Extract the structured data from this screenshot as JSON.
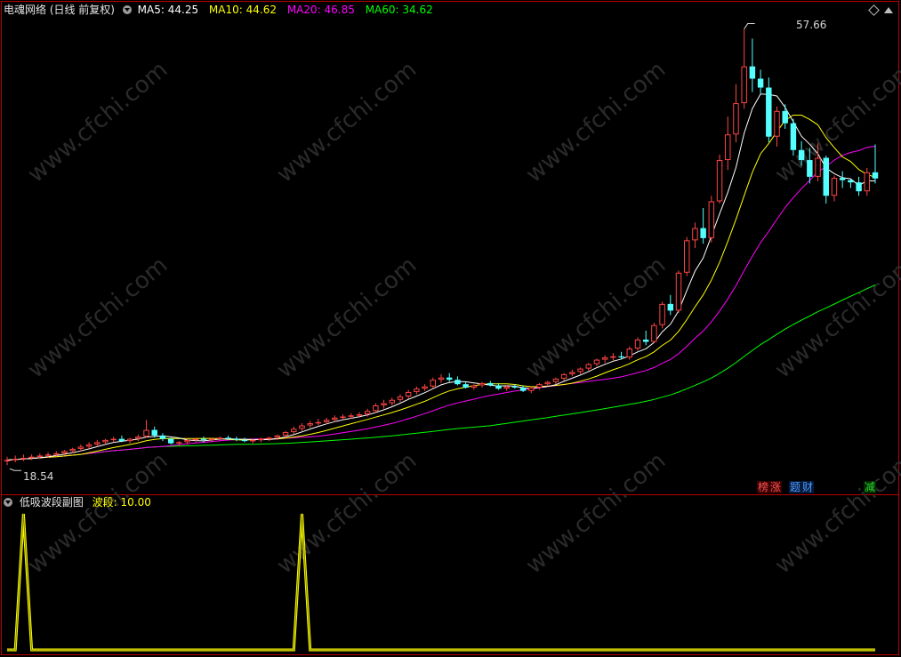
{
  "main_panel": {
    "title": "电魂网络 (日线 前复权)",
    "ma": [
      {
        "label": "MA5:",
        "value": "44.25",
        "color": "#ffffff"
      },
      {
        "label": "MA10:",
        "value": "44.62",
        "color": "#ffff00"
      },
      {
        "label": "MA20:",
        "value": "46.85",
        "color": "#ff00ff"
      },
      {
        "label": "MA60:",
        "value": "34.62",
        "color": "#00ff00"
      }
    ],
    "high_label": "57.66",
    "low_label": "18.54",
    "tags": [
      {
        "text": "榜",
        "color": "#ff5555"
      },
      {
        "text": "涨",
        "color": "#ff5555"
      },
      {
        "text": "题",
        "color": "#5599ff"
      },
      {
        "text": "财",
        "color": "#5599ff"
      },
      {
        "text": "减",
        "color": "#33dd33"
      }
    ]
  },
  "sub_panel": {
    "title": "低吸波段副图",
    "series_label": "波段:",
    "series_value": "10.00"
  },
  "watermark": "www.cfchi.com",
  "colors": {
    "up": "#ff4444",
    "down": "#54ffff",
    "ma5": "#ffffff",
    "ma10": "#ffff00",
    "ma20": "#ff00ff",
    "ma60": "#00ff00",
    "band": "#ffff00",
    "frame": "#bb0000"
  },
  "chart_data": [
    {
      "type": "candlestick",
      "title": "电魂网络 (日线 前复权)",
      "ylim": [
        18.0,
        58.5
      ],
      "annotations": {
        "high": 57.66,
        "low": 18.54
      },
      "ohlc": [
        [
          18.9,
          19.3,
          18.54,
          19.0
        ],
        [
          19.0,
          19.4,
          18.8,
          19.1
        ],
        [
          19.1,
          19.5,
          18.9,
          19.2
        ],
        [
          19.2,
          19.5,
          19.0,
          19.3
        ],
        [
          19.3,
          19.6,
          19.1,
          19.4
        ],
        [
          19.4,
          19.7,
          19.2,
          19.5
        ],
        [
          19.5,
          19.8,
          19.3,
          19.6
        ],
        [
          19.6,
          19.9,
          19.4,
          19.8
        ],
        [
          19.8,
          20.1,
          19.6,
          20.0
        ],
        [
          20.0,
          20.4,
          19.8,
          20.2
        ],
        [
          20.2,
          20.6,
          20.0,
          20.4
        ],
        [
          20.4,
          20.8,
          20.2,
          20.6
        ],
        [
          20.6,
          20.9,
          20.4,
          20.8
        ],
        [
          20.8,
          21.1,
          20.6,
          20.9
        ],
        [
          20.9,
          21.2,
          20.6,
          20.7
        ],
        [
          20.7,
          21.0,
          20.5,
          20.9
        ],
        [
          20.9,
          21.3,
          20.7,
          21.1
        ],
        [
          21.1,
          22.6,
          21.0,
          21.7
        ],
        [
          21.7,
          22.0,
          21.0,
          21.2
        ],
        [
          21.2,
          21.4,
          20.7,
          20.9
        ],
        [
          20.9,
          21.0,
          20.4,
          20.5
        ],
        [
          20.5,
          20.7,
          20.3,
          20.6
        ],
        [
          20.6,
          20.9,
          20.4,
          20.8
        ],
        [
          20.8,
          21.0,
          20.6,
          20.9
        ],
        [
          20.9,
          21.1,
          20.6,
          20.8
        ],
        [
          20.8,
          21.0,
          20.6,
          20.9
        ],
        [
          20.9,
          21.1,
          20.7,
          21.0
        ],
        [
          21.0,
          21.2,
          20.8,
          20.9
        ],
        [
          20.9,
          21.1,
          20.7,
          20.8
        ],
        [
          20.8,
          21.0,
          20.6,
          20.7
        ],
        [
          20.7,
          20.9,
          20.5,
          20.8
        ],
        [
          20.8,
          21.0,
          20.6,
          20.9
        ],
        [
          20.9,
          21.1,
          20.7,
          21.0
        ],
        [
          21.0,
          21.3,
          20.8,
          21.2
        ],
        [
          21.2,
          21.6,
          21.0,
          21.5
        ],
        [
          21.5,
          22.0,
          21.3,
          21.8
        ],
        [
          21.8,
          22.3,
          21.6,
          22.1
        ],
        [
          22.1,
          22.5,
          21.9,
          22.3
        ],
        [
          22.3,
          22.7,
          22.1,
          22.4
        ],
        [
          22.4,
          22.8,
          22.2,
          22.6
        ],
        [
          22.6,
          23.0,
          22.4,
          22.8
        ],
        [
          22.8,
          23.1,
          22.6,
          22.9
        ],
        [
          22.9,
          23.2,
          22.7,
          23.0
        ],
        [
          23.0,
          23.3,
          22.8,
          23.1
        ],
        [
          23.1,
          23.6,
          22.9,
          23.4
        ],
        [
          23.4,
          24.1,
          23.2,
          23.9
        ],
        [
          23.9,
          24.4,
          23.6,
          24.1
        ],
        [
          24.1,
          24.6,
          23.9,
          24.4
        ],
        [
          24.4,
          24.9,
          24.2,
          24.7
        ],
        [
          24.7,
          25.3,
          24.5,
          25.1
        ],
        [
          25.1,
          25.6,
          24.9,
          25.4
        ],
        [
          25.4,
          25.8,
          25.2,
          25.6
        ],
        [
          25.6,
          26.4,
          25.4,
          26.2
        ],
        [
          26.2,
          26.7,
          25.9,
          26.4
        ],
        [
          26.4,
          26.8,
          26.0,
          26.2
        ],
        [
          26.2,
          26.5,
          25.7,
          25.8
        ],
        [
          25.8,
          26.0,
          25.4,
          25.5
        ],
        [
          25.5,
          25.8,
          25.3,
          25.7
        ],
        [
          25.7,
          26.0,
          25.5,
          25.9
        ],
        [
          25.9,
          26.1,
          25.6,
          25.7
        ],
        [
          25.7,
          25.9,
          25.3,
          25.4
        ],
        [
          25.4,
          25.7,
          25.2,
          25.6
        ],
        [
          25.6,
          25.8,
          25.4,
          25.5
        ],
        [
          25.5,
          25.7,
          25.1,
          25.2
        ],
        [
          25.2,
          25.6,
          25.0,
          25.5
        ],
        [
          25.5,
          25.9,
          25.3,
          25.8
        ],
        [
          25.8,
          26.1,
          25.6,
          26.0
        ],
        [
          26.0,
          26.4,
          25.8,
          26.3
        ],
        [
          26.3,
          26.8,
          26.1,
          26.7
        ],
        [
          26.7,
          27.1,
          26.5,
          26.9
        ],
        [
          26.9,
          27.3,
          26.7,
          27.2
        ],
        [
          27.2,
          27.7,
          27.0,
          27.6
        ],
        [
          27.6,
          28.1,
          27.4,
          28.0
        ],
        [
          28.0,
          28.4,
          27.7,
          28.2
        ],
        [
          28.2,
          28.6,
          27.9,
          28.3
        ],
        [
          28.3,
          28.7,
          28.0,
          28.2
        ],
        [
          28.2,
          29.2,
          28.0,
          29.0
        ],
        [
          29.0,
          30.0,
          28.8,
          29.8
        ],
        [
          29.8,
          30.6,
          29.3,
          29.6
        ],
        [
          29.6,
          31.3,
          29.5,
          31.1
        ],
        [
          31.1,
          33.2,
          30.8,
          33.0
        ],
        [
          33.0,
          33.8,
          32.0,
          32.4
        ],
        [
          32.4,
          36.0,
          32.2,
          35.8
        ],
        [
          35.8,
          39.0,
          35.5,
          38.7
        ],
        [
          38.7,
          40.3,
          38.0,
          39.8
        ],
        [
          39.8,
          41.6,
          38.4,
          38.9
        ],
        [
          38.9,
          42.7,
          38.5,
          42.2
        ],
        [
          42.2,
          46.4,
          42.0,
          45.9
        ],
        [
          45.9,
          49.8,
          45.0,
          48.2
        ],
        [
          48.2,
          52.7,
          47.5,
          51.0
        ],
        [
          51.0,
          57.66,
          50.5,
          54.3
        ],
        [
          54.3,
          56.8,
          52.0,
          53.2
        ],
        [
          53.2,
          54.0,
          51.8,
          52.4
        ],
        [
          52.4,
          53.3,
          47.5,
          48.0
        ],
        [
          48.0,
          50.7,
          47.1,
          50.3
        ],
        [
          50.3,
          50.9,
          48.7,
          49.2
        ],
        [
          49.2,
          49.6,
          46.3,
          46.8
        ],
        [
          46.8,
          47.6,
          45.4,
          45.9
        ],
        [
          45.9,
          47.0,
          43.8,
          44.4
        ],
        [
          44.4,
          47.4,
          44.0,
          46.1
        ],
        [
          46.1,
          46.3,
          42.0,
          42.7
        ],
        [
          42.7,
          44.5,
          42.2,
          44.3
        ],
        [
          44.3,
          44.9,
          43.4,
          44.1
        ],
        [
          44.1,
          44.2,
          43.4,
          43.9
        ],
        [
          43.9,
          44.4,
          42.7,
          43.1
        ],
        [
          43.1,
          45.2,
          42.7,
          44.8
        ],
        [
          44.8,
          47.3,
          43.8,
          44.25
        ]
      ],
      "series": [
        {
          "name": "MA5",
          "value": 44.25
        },
        {
          "name": "MA10",
          "value": 44.62
        },
        {
          "name": "MA20",
          "value": 46.85
        },
        {
          "name": "MA60",
          "value": 34.62
        }
      ]
    },
    {
      "type": "line",
      "title": "低吸波段副图",
      "series": [
        {
          "name": "波段",
          "values": [
            0,
            0,
            10,
            0,
            0,
            0,
            0,
            0,
            0,
            0,
            0,
            0,
            0,
            0,
            0,
            0,
            0,
            0,
            0,
            0,
            0,
            0,
            0,
            0,
            0,
            0,
            0,
            0,
            0,
            0,
            0,
            0,
            0,
            0,
            0,
            0,
            10,
            0,
            0,
            0,
            0,
            0,
            0,
            0,
            0,
            0,
            0,
            0,
            0,
            0,
            0,
            0,
            0,
            0,
            0,
            0,
            0,
            0,
            0,
            0,
            0,
            0,
            0,
            0,
            0,
            0,
            0,
            0,
            0,
            0,
            0,
            0,
            0,
            0,
            0,
            0,
            0,
            0,
            0,
            0,
            0,
            0,
            0,
            0,
            0,
            0,
            0,
            0,
            0,
            0,
            0,
            0,
            0,
            0,
            0,
            0,
            0,
            0,
            0,
            0,
            0,
            0,
            0,
            0,
            0,
            0,
            0
          ]
        }
      ],
      "ylim": [
        0,
        10
      ]
    }
  ]
}
